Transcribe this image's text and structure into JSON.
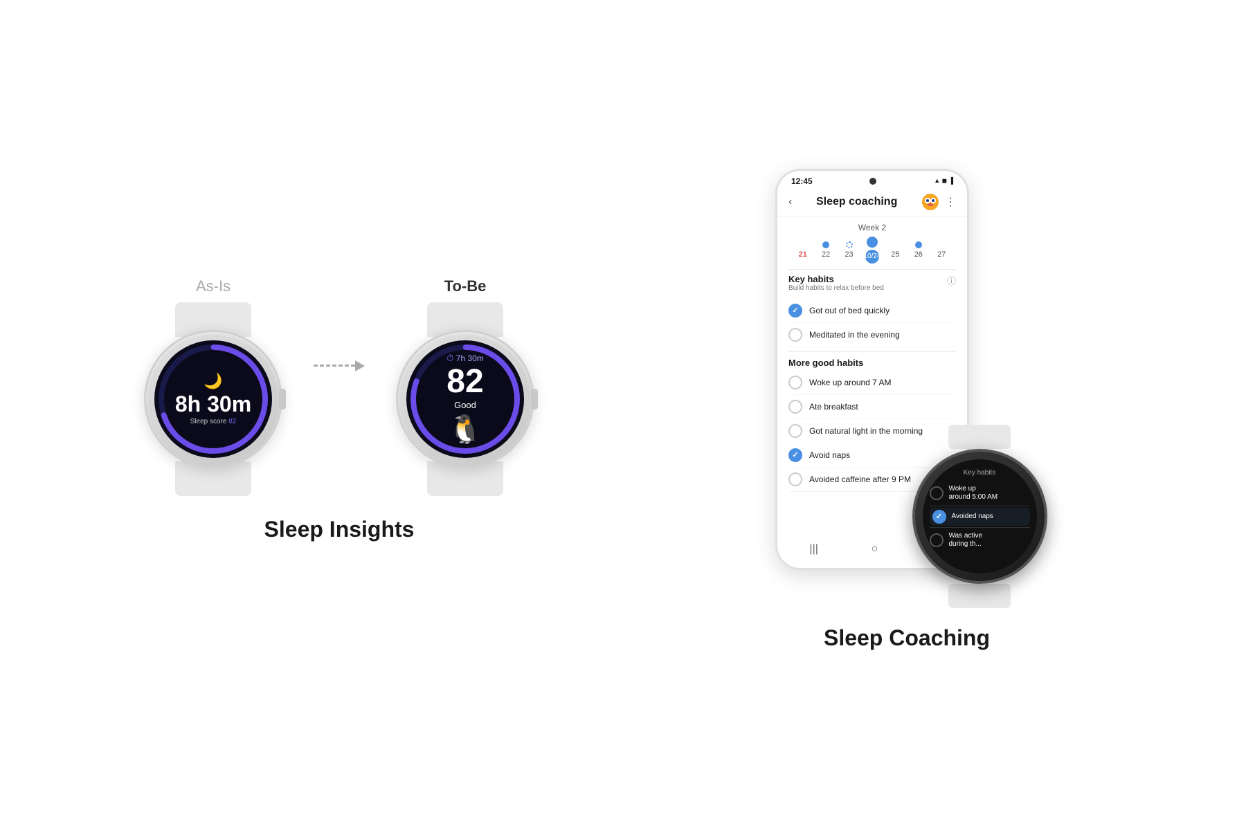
{
  "page": {
    "background": "#ffffff"
  },
  "sleep_insights": {
    "label": "Sleep Insights",
    "as_is_label": "As-Is",
    "to_be_label": "To-Be",
    "watch_asis": {
      "sleep_hours": "8",
      "sleep_minutes": "30",
      "unit_h": "h",
      "unit_m": "m",
      "sleep_score_text": "Sleep score 82"
    },
    "watch_tobe": {
      "duration": "7h 30m",
      "score": "82",
      "quality": "Good"
    }
  },
  "sleep_coaching": {
    "label": "Sleep Coaching",
    "phone": {
      "status_time": "12:45",
      "header_title": "Sleep coaching",
      "week_label": "Week 2",
      "calendar": {
        "days": [
          {
            "num": "21",
            "style": "red",
            "dot": "none"
          },
          {
            "num": "22",
            "style": "normal",
            "dot": "small"
          },
          {
            "num": "23",
            "style": "normal",
            "dot": "dotted"
          },
          {
            "num": "10/24",
            "style": "active",
            "dot": "large"
          },
          {
            "num": "25",
            "style": "normal",
            "dot": "none"
          },
          {
            "num": "26",
            "style": "normal",
            "dot": "small"
          },
          {
            "num": "27",
            "style": "normal",
            "dot": "none"
          }
        ]
      },
      "key_habits_title": "Key habits",
      "key_habits_subtitle": "Build habits to relax before bed",
      "habits": [
        {
          "text": "Got out of bed quickly",
          "checked": true
        },
        {
          "text": "Meditated in the evening",
          "checked": false
        }
      ],
      "more_habits_title": "More good habits",
      "more_habits": [
        {
          "text": "Woke up around 7 AM",
          "checked": false
        },
        {
          "text": "Ate breakfast",
          "checked": false
        },
        {
          "text": "Got natural light in the morning",
          "checked": false
        },
        {
          "text": "Avoid naps",
          "checked": true
        },
        {
          "text": "Avoided caffeine after 9 PM",
          "checked": false
        }
      ]
    },
    "watch": {
      "title": "Key habits",
      "items": [
        {
          "text": "Woke up around 5:00 AM",
          "checked": false
        },
        {
          "text": "Avoided naps",
          "checked": true
        },
        {
          "text": "Was active during th...",
          "checked": false
        }
      ]
    }
  }
}
